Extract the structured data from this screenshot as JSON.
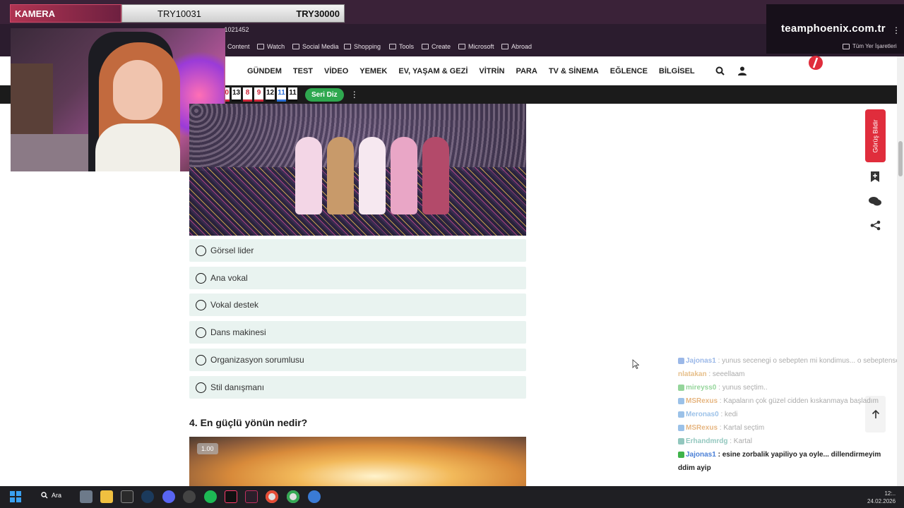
{
  "overlay": {
    "camera_label": "KAMERA",
    "try_left": "TRY10031",
    "try_right": "TRY30000",
    "brand": "teamphoenix.com.tr"
  },
  "browser": {
    "url": "...1021452",
    "bookmarks": [
      "Content",
      "Watch",
      "Social Media",
      "Shopping",
      "Tools",
      "Create",
      "Microsoft",
      "Abroad"
    ],
    "bookmarks_right": "Tüm Yer İşaretleri"
  },
  "nav": {
    "items": [
      "GÜNDEM",
      "TEST",
      "VİDEO",
      "YEMEK",
      "EV, YAŞAM & GEZİ",
      "VİTRİN",
      "PARA",
      "TV & SİNEMA",
      "EĞLENCE",
      "BİLGİSEL"
    ]
  },
  "scores": {
    "numbers": [
      "10",
      "13",
      "8",
      "9",
      "12",
      "11",
      "11"
    ],
    "colors": [
      "#d0263a",
      "#111111",
      "#d0263a",
      "#d0263a",
      "#111111",
      "#2a6fd6",
      "#111111"
    ],
    "button": "Seri Diz"
  },
  "quiz": {
    "options": [
      "Görsel lider",
      "Ana vokal",
      "Vokal destek",
      "Dans makinesi",
      "Organizasyon sorumlusu",
      "Stil danışmanı"
    ],
    "question4": "4. En güçlü yönün nedir?",
    "q4_badge": "1.00"
  },
  "sidebar": {
    "feedback": "Görüş Bildir"
  },
  "chat": {
    "messages": [
      {
        "user": "Jajonas1",
        "color": "#4a7fd6",
        "text": " : yunus secenegi o sebepten mi kondimus... o sebeptense cok ayb"
      },
      {
        "user": "nlatakan",
        "color": "#d28a2a",
        "text": " : seeellaam"
      },
      {
        "user": "mireyss0",
        "color": "#3fb34a",
        "text": " : yunus seçtim.."
      },
      {
        "user": "MSRexus",
        "color": "#d27a1a",
        "text": " : Kapaların çok güzel cidden kıskanmaya başladım"
      },
      {
        "user": "Meronas0",
        "color": "#4a8fd6",
        "text": " : kedi"
      },
      {
        "user": "MSRexus",
        "color": "#d27a1a",
        "text": " : Kartal seçtim"
      },
      {
        "user": "Erhandmrdg",
        "color": "#3a9a8a",
        "text": " : Kartal"
      }
    ],
    "last_user": "Jajonas1",
    "last_text": " : esine zorbalik yapiliyo ya oyle... dillendirmeyim",
    "last_text2": "ddim ayip"
  },
  "taskbar": {
    "search": "Ara",
    "time": "12:..",
    "date": "24.02.2026"
  }
}
